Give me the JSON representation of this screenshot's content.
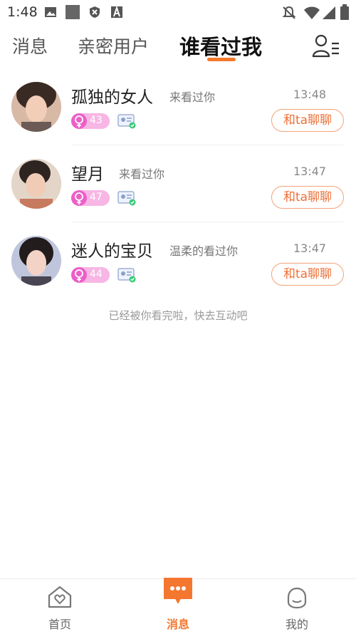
{
  "status_bar": {
    "time": "1:48",
    "icons_left": [
      "image-icon",
      "square-icon",
      "shield-icon",
      "font-icon"
    ],
    "icons_right": [
      "bell-muted-icon",
      "wifi-icon",
      "signal-icon",
      "battery-icon"
    ]
  },
  "tabs": [
    {
      "label": "消息",
      "active": false
    },
    {
      "label": "亲密用户",
      "active": false
    },
    {
      "label": "谁看过我",
      "active": true
    }
  ],
  "header": {
    "contacts_icon": "contacts-list-icon"
  },
  "accent_color": "#f5792a",
  "visitors": [
    {
      "name": "孤独的女人",
      "action": "来看过你",
      "time": "13:48",
      "age": "43",
      "gender_icon": "female-icon",
      "verified_icon": "id-verified-icon",
      "button": "和ta聊聊"
    },
    {
      "name": "望月",
      "action": "来看过你",
      "time": "13:47",
      "age": "47",
      "gender_icon": "female-icon",
      "verified_icon": "id-verified-icon",
      "button": "和ta聊聊"
    },
    {
      "name": "迷人的宝贝",
      "action": "温柔的看过你",
      "time": "13:47",
      "age": "44",
      "gender_icon": "female-icon",
      "verified_icon": "id-verified-icon",
      "button": "和ta聊聊"
    }
  ],
  "end_note": "已经被你看完啦，快去互动吧",
  "bottom_nav": [
    {
      "label": "首页",
      "icon": "home-heart-icon",
      "active": false
    },
    {
      "label": "消息",
      "icon": "message-bubble-icon",
      "active": true
    },
    {
      "label": "我的",
      "icon": "profile-icon",
      "active": false
    }
  ]
}
